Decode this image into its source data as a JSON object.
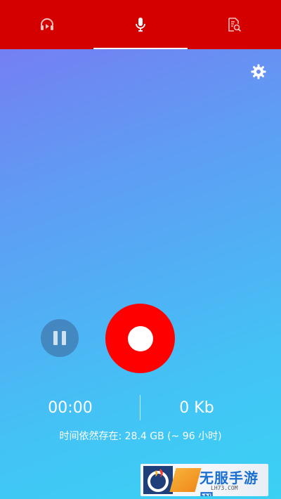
{
  "tabs": [
    {
      "name": "player",
      "icon": "headphones-play-icon",
      "active": false
    },
    {
      "name": "recorder",
      "icon": "microphone-icon",
      "active": true
    },
    {
      "name": "files",
      "icon": "file-search-icon",
      "active": false
    }
  ],
  "settings": {
    "icon": "gear-icon"
  },
  "controls": {
    "pause_icon": "pause-icon",
    "record_icon": "record-icon"
  },
  "stats": {
    "elapsed_time": "00:00",
    "file_size": "0 Kb"
  },
  "storage": {
    "text": "时间依然存在:  28.4 GB (~ 96 小时)"
  },
  "watermark": {
    "text": "无服手游网",
    "url": "LH73.COM"
  },
  "colors": {
    "tab_bar": "#d40000",
    "record_button": "#ff0000",
    "gradient_top": "#7b76f1",
    "gradient_bottom": "#3ad1f4"
  }
}
